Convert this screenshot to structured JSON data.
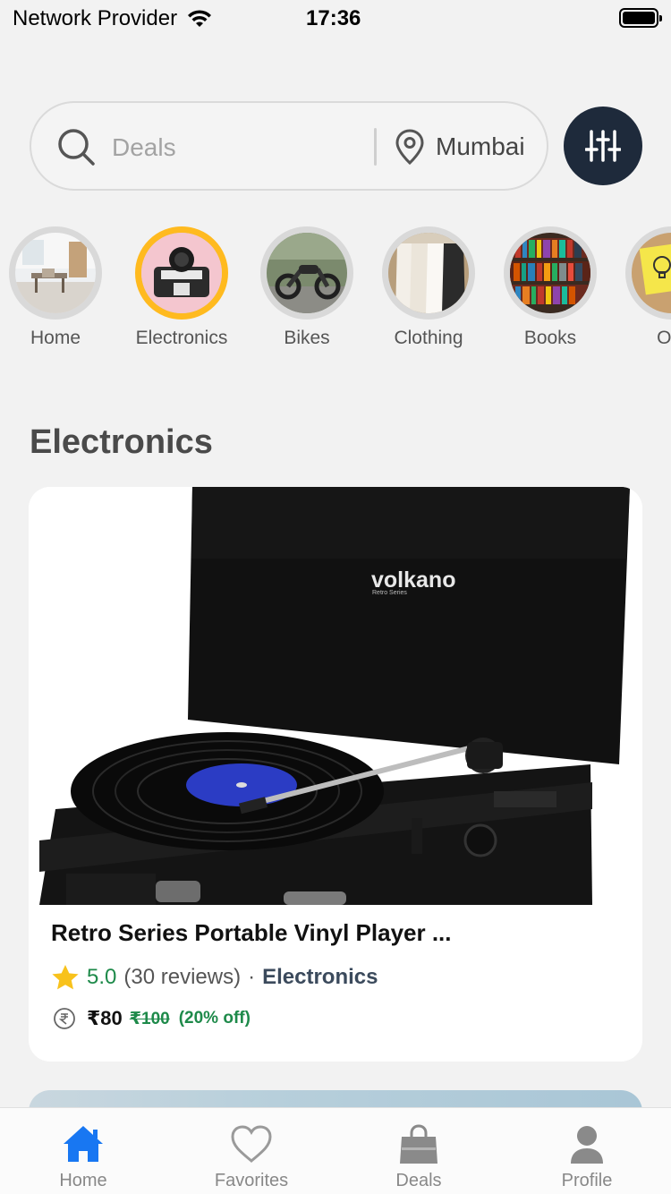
{
  "status_bar": {
    "provider": "Network Provider",
    "time": "17:36"
  },
  "search": {
    "placeholder": "Deals",
    "location": "Mumbai"
  },
  "categories": [
    {
      "label": "Home",
      "selected": false
    },
    {
      "label": "Electronics",
      "selected": true
    },
    {
      "label": "Bikes",
      "selected": false
    },
    {
      "label": "Clothing",
      "selected": false
    },
    {
      "label": "Books",
      "selected": false
    },
    {
      "label": "Oth",
      "selected": false
    }
  ],
  "section": {
    "title": "Electronics"
  },
  "product": {
    "title": "Retro Series Portable Vinyl Player ...",
    "brand_text": "volkano",
    "brand_sub": "Retro Series",
    "rating": "5.0",
    "reviews": "(30 reviews)",
    "separator": "·",
    "category": "Electronics",
    "price": "₹80",
    "original_price": "₹100",
    "discount": "(20% off)"
  },
  "tab_bar": {
    "tabs": [
      {
        "label": "Home",
        "active": true
      },
      {
        "label": "Favorites",
        "active": false
      },
      {
        "label": "Deals",
        "active": false
      },
      {
        "label": "Profile",
        "active": false
      }
    ]
  },
  "colors": {
    "accent_blue": "#1877f2",
    "selected_ring": "#ffba1f",
    "filter_button": "#1e2a3b",
    "green": "#1e8a4a",
    "star": "#f8c21c"
  },
  "icons": [
    "wifi-icon",
    "battery-icon",
    "search-icon",
    "location-pin-icon",
    "sliders-icon",
    "star-icon",
    "rupee-icon",
    "home-icon",
    "heart-icon",
    "shopping-bag-icon",
    "user-icon"
  ]
}
